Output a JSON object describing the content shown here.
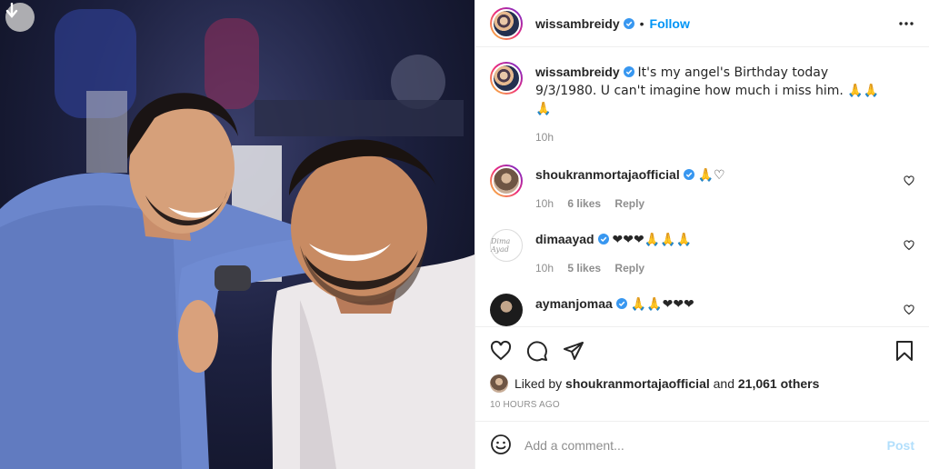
{
  "post": {
    "author": "wissambreidy",
    "follow_label": "Follow",
    "separator": "•",
    "caption_text": "It's my angel's Birthday today 9/3/1980. U can't imagine how much i miss him. 🙏🙏🙏",
    "caption_time": "10h"
  },
  "comments": [
    {
      "user": "shoukranmortajaofficial",
      "text": "🙏♡",
      "time": "10h",
      "likes": "6 likes",
      "reply": "Reply"
    },
    {
      "user": "dimaayad",
      "text": "❤❤❤🙏🙏🙏",
      "time": "10h",
      "likes": "5 likes",
      "reply": "Reply",
      "avatar_text": "Dima Ayad"
    },
    {
      "user": "aymanjomaa",
      "text": "🙏🙏❤❤❤"
    }
  ],
  "likes": {
    "prefix": "Liked by",
    "user": "shoukranmortajaofficial",
    "middle": "and",
    "count": "21,061 others"
  },
  "timestamp": "10 HOURS AGO",
  "add_comment": {
    "placeholder": "Add a comment...",
    "post_label": "Post"
  },
  "colors": {
    "accent": "#0095f6",
    "post_disabled": "#b2dffc",
    "heart_red": "#e0245e",
    "verified": "#3897f0"
  },
  "icons": [
    "download-icon",
    "more-icon",
    "verified-icon",
    "heart-icon",
    "comment-icon",
    "share-icon",
    "bookmark-icon",
    "emoji-icon"
  ]
}
